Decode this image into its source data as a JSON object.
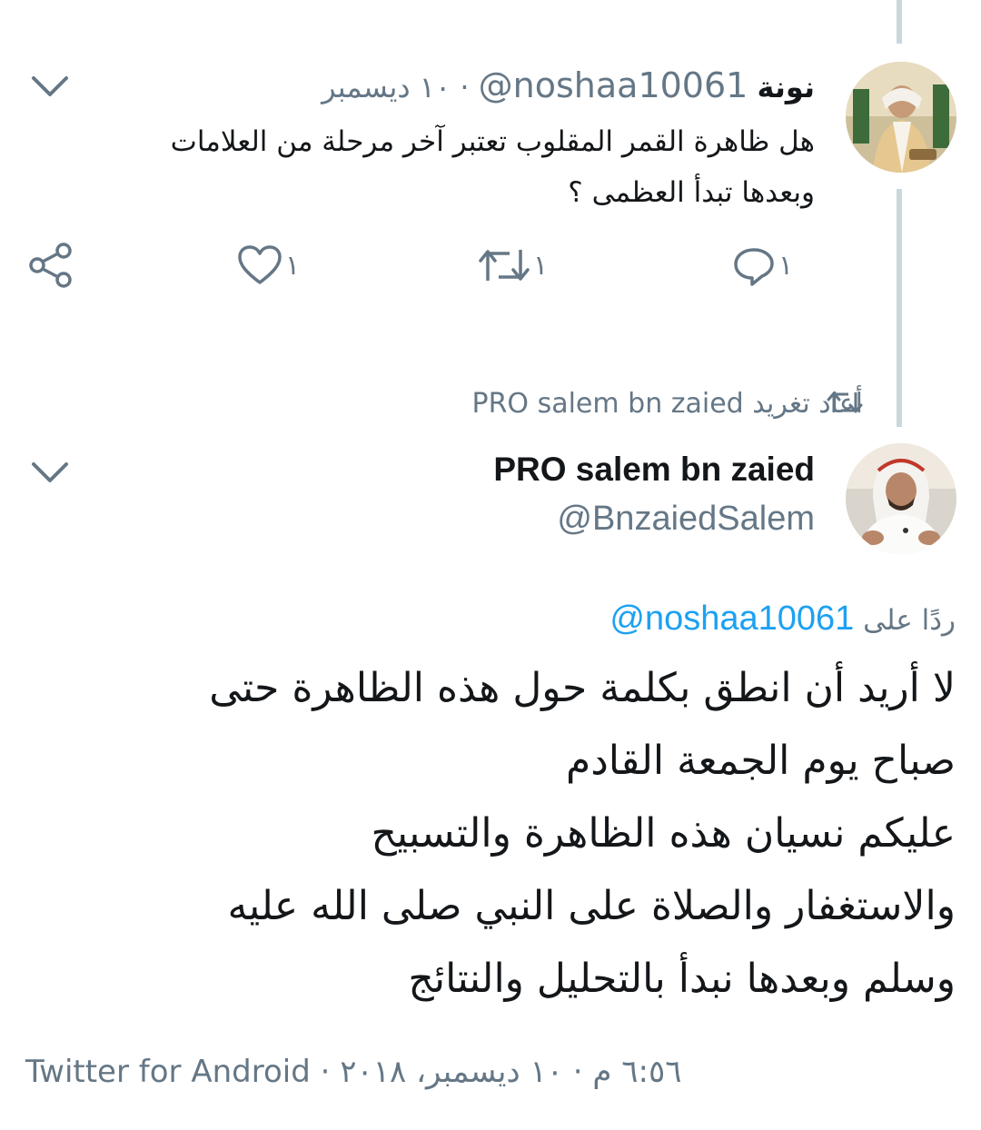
{
  "tweet1": {
    "name": "نونة",
    "handle": "@noshaa10061",
    "separator": "·",
    "date": "١٠ ديسمبر",
    "text_line1": "هل ظاهرة القمر المقلوب تعتبر آخر مرحلة من العلامات",
    "text_line2": "وبعدها تبدأ العظمى ؟",
    "actions": {
      "reply_count": "١",
      "retweet_count": "١",
      "like_count": "١"
    },
    "avatar_icon": "profile-photo"
  },
  "retweet_banner": {
    "text": "PRO salem bn zaied أعاد تغريد",
    "icon": "retweet-icon"
  },
  "tweet2": {
    "name": "PRO salem bn zaied",
    "handle": "@BnzaiedSalem",
    "reply_label": "ردًا على",
    "reply_handle": "@noshaa10061",
    "lines": [
      "لا أريد أن انطق بكلمة حول هذه الظاهرة حتى",
      "صباح يوم الجمعة القادم",
      "عليكم نسيان هذه الظاهرة والتسبيح",
      "والاستغفار والصلاة على النبي صلى الله عليه",
      "وسلم وبعدها نبدأ بالتحليل والنتائج"
    ],
    "meta": "٦:٥٦ م · ١٠ ديسمبر، ٢٠١٨ · Twitter for Android"
  },
  "colors": {
    "accent": "#1da1f2",
    "muted": "#657786",
    "thread": "#ccd6dd"
  }
}
